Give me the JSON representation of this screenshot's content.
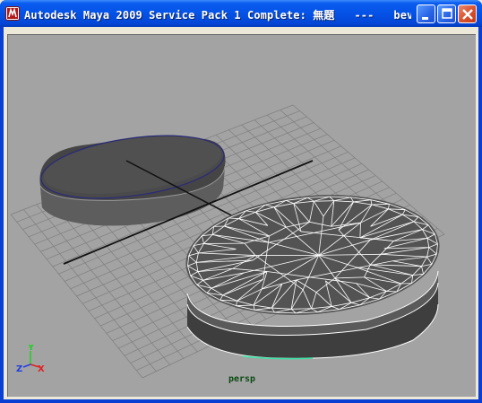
{
  "window": {
    "title": "Autodesk Maya 2009 Service Pack 1 Complete: 無題   ---   bev..."
  },
  "titlebar_buttons": {
    "minimize": "minimize-icon",
    "maximize": "maximize-icon",
    "close": "close-icon"
  },
  "viewport": {
    "camera_label": "persp",
    "background_color": "#a3a3a3"
  },
  "axis_gizmo": {
    "x_label": "X",
    "y_label": "Y",
    "z_label": "Z",
    "x_color": "#e02020",
    "y_color": "#20d020",
    "z_color": "#2040e0"
  }
}
